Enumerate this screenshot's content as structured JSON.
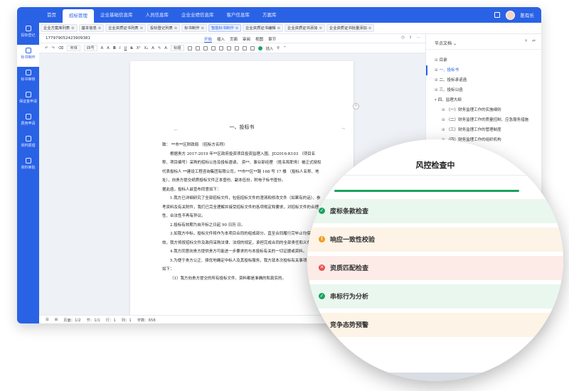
{
  "nav": {
    "items": [
      "首页",
      "招标管理",
      "企业基础信息库",
      "人员信息库",
      "企业业绩信息库",
      "客户信息库",
      "方案库"
    ],
    "active_index": 1,
    "user_name": "陈有乐"
  },
  "sidebar": {
    "items": [
      "投标登记",
      "标书制作",
      "标书审核",
      "保证金申请",
      "费用申请",
      "资料报错",
      "资料审批"
    ],
    "active_index": 1
  },
  "tabs": [
    "企业方案库列表",
    "基本信息",
    "企业资质证书列表",
    "投标登记列表",
    "标书制作",
    "智能标书制作",
    "企业资质证书编辑",
    "企业资质证书添加",
    "企业资质证书批量添加"
  ],
  "active_tab_index": 5,
  "doc": {
    "id": "177979052423909381",
    "menu": [
      "开始",
      "插入",
      "页面",
      "审阅",
      "视图",
      "章节"
    ],
    "active_menu_index": 0,
    "toolbar": {
      "font": "宋体",
      "size": "四号",
      "heading": "标题",
      "insert": "插入"
    },
    "title": "一、投标书",
    "paragraphs": [
      "致：  **市**区财政局  （招标方名称）",
      "根据贵方  2017-2019 年**区政府投资项目投资监理入围、JD2016-K103  （项目名称、项目编号）采购的招标公告及投标邀请， 资**、事业部经理  （姓名和职务）被正式授权代表投标人 **建设工程咨询集团有限公司，**市**区**路 168 号 17 楼  （投标人名称、地址），向贵方提交纸质投标文件正本壹份、副本伍份，附电子标书壹份。",
      "据此函，投标人兹宣布同意如下：",
      "1.我方已详细研究了全部招标文件，包括招标文件的澄清和修改文件（如果有的话）、参考资料及有关附件，我们已完全理解并接受招标文件的各项规定和要求，对招标文件的合理性、合法性不再有异议。",
      "2.投标有效期为自开标之日起  90 日历  日。",
      "3.如我方中标，投标文件将作为本项目合同的组成部分。直至合同履行完毕止均保持有效，我方将按招标文件及政府采购法律、法规的规定，承担完成合同的全部责任和义务。",
      "4.我方同意向贵方提供贵方可能进一步要求的与本投标有关的一切证据或资料。",
      "5.为便于贵方公正、择优地确定中标人及其投标服务，我方就本次投标有关事项郑重声明如下：",
      "（1）我方向贵方提交的所有投标文件、资料都是准确的和真实的。"
    ],
    "status": {
      "page": "页面：1/2",
      "section": "节：1/1",
      "row": "行：1",
      "col": "列：1",
      "words": "字数：658"
    }
  },
  "outline": {
    "title": "节点文档",
    "items": [
      {
        "label": "目录",
        "level": 1
      },
      {
        "label": "一、投标书",
        "level": 1,
        "active": true
      },
      {
        "label": "二、投标承诺函",
        "level": 1
      },
      {
        "label": "三、投标公函",
        "level": 1
      },
      {
        "label": "四、监理大纲",
        "level": 1
      },
      {
        "label": "（一）财务监理工作的实施细则",
        "level": 2
      },
      {
        "label": "（二）财务监理工作的质量控制、应急服务措施",
        "level": 2
      },
      {
        "label": "（三）财务监理工作的管理制度",
        "level": 2
      },
      {
        "label": "（四）财务监理工作的组织机构",
        "level": 2
      }
    ]
  },
  "risk_panel": {
    "title": "风控检查中",
    "progress": 1.0,
    "items": [
      {
        "label": "废标条款检查",
        "status": "ok"
      },
      {
        "label": "响应一致性校验",
        "status": "warn"
      },
      {
        "label": "资质匹配检查",
        "status": "err"
      },
      {
        "label": "串标行为分析",
        "status": "ok"
      },
      {
        "label": "竞争态势预警",
        "status": "warn"
      }
    ]
  }
}
